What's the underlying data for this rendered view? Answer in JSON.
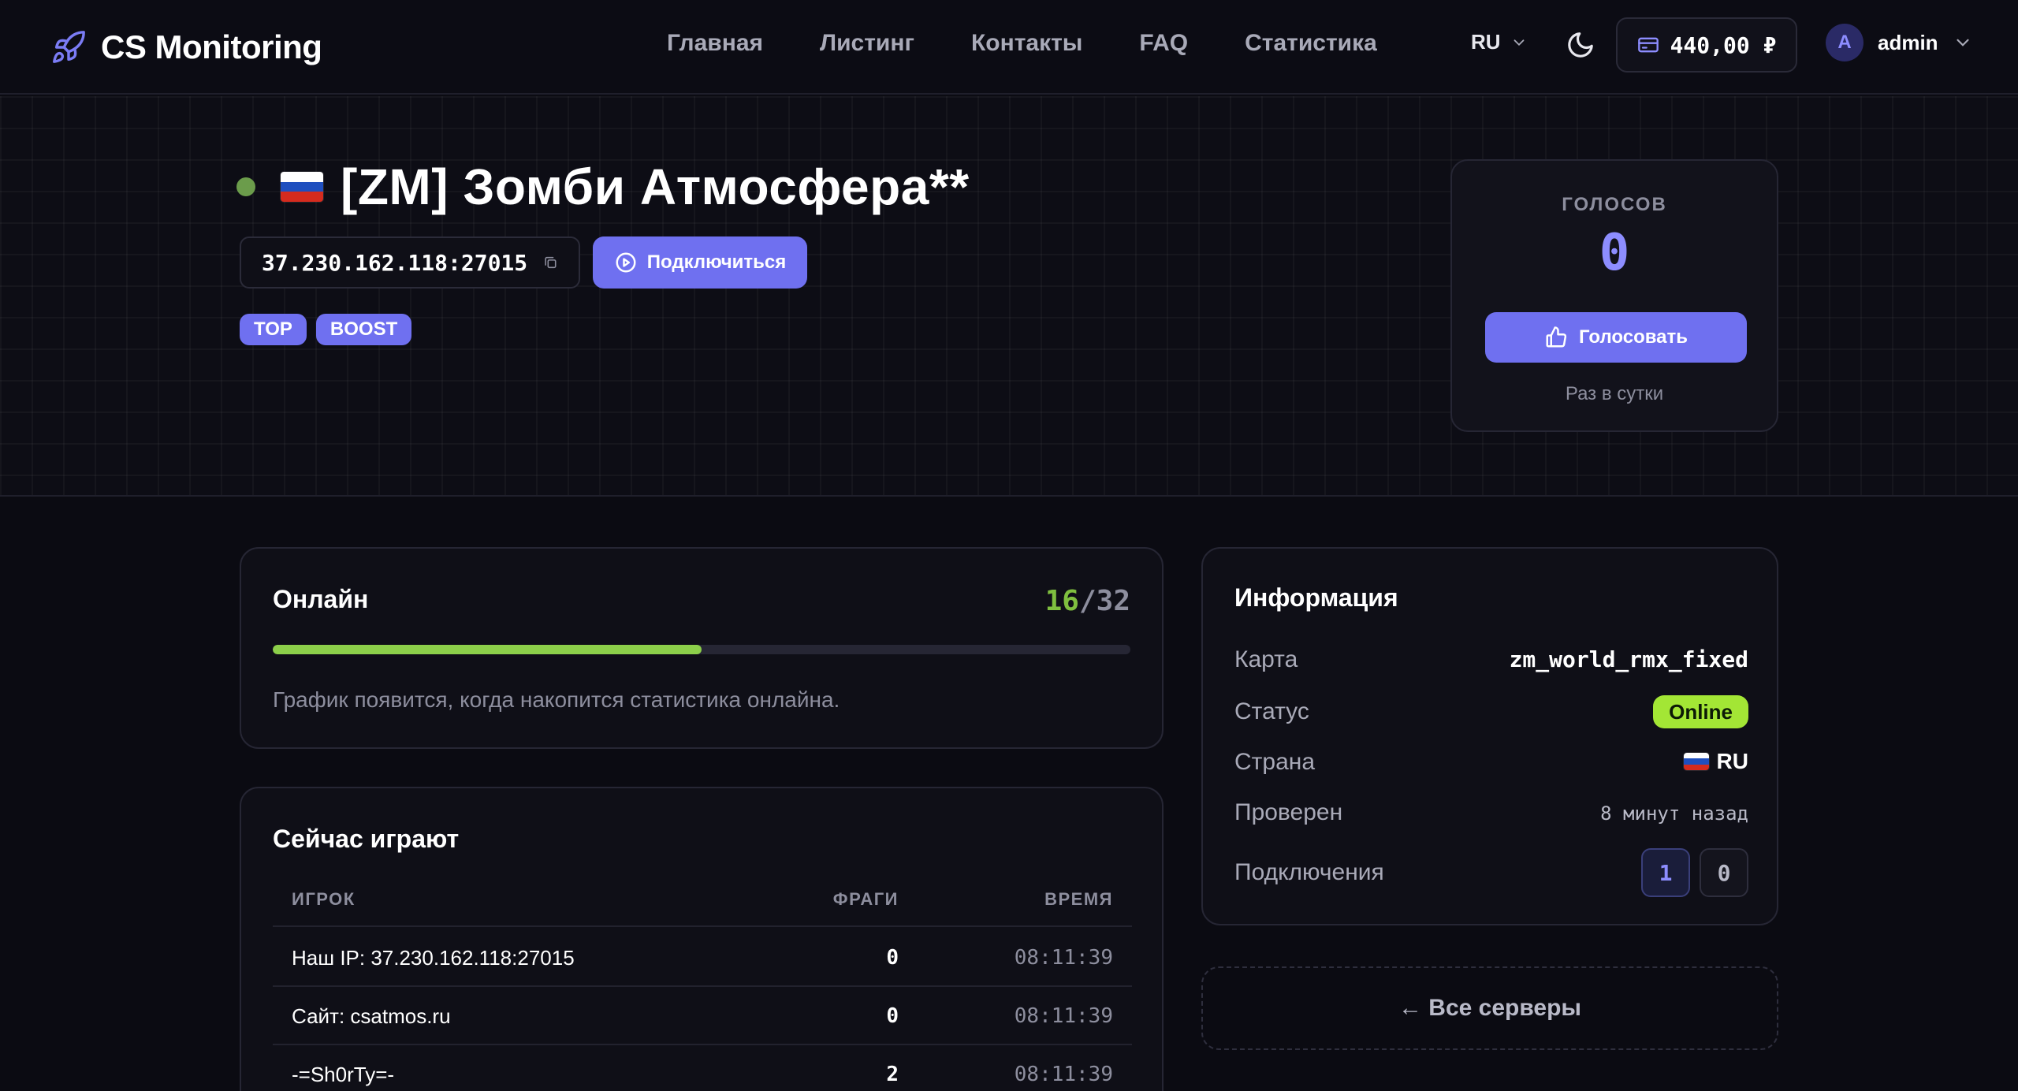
{
  "header": {
    "brand": "CS Monitoring",
    "nav": [
      "Главная",
      "Листинг",
      "Контакты",
      "FAQ",
      "Статистика"
    ],
    "lang": "RU",
    "balance": "440,00 ₽",
    "avatar_letter": "A",
    "username": "admin"
  },
  "server": {
    "title": "[ZM] Зомби Атмосфера**",
    "ip": "37.230.162.118:27015",
    "connect_label": "Подключиться",
    "tags": [
      "TOP",
      "BOOST"
    ]
  },
  "vote": {
    "label": "ГОЛОСОВ",
    "count": "0",
    "button_label": "Голосовать",
    "note": "Раз в сутки"
  },
  "online": {
    "title": "Онлайн",
    "current": "16",
    "separator": "/",
    "max": "32",
    "fraction": 0.5,
    "note": "График появится, когда накопится статистика онлайна."
  },
  "players": {
    "title": "Сейчас играют",
    "columns": [
      "ИГРОК",
      "ФРАГИ",
      "ВРЕМЯ"
    ],
    "rows": [
      {
        "name": "Наш IP: 37.230.162.118:27015",
        "frags": "0",
        "time": "08:11:39"
      },
      {
        "name": "Сайт: csatmos.ru",
        "frags": "0",
        "time": "08:11:39"
      },
      {
        "name": "-=Sh0rTy=-",
        "frags": "2",
        "time": "08:11:39"
      }
    ]
  },
  "info": {
    "title": "Информация",
    "map_label": "Карта",
    "map_value": "zm_world_rmx_fixed",
    "status_label": "Статус",
    "status_value": "Online",
    "country_label": "Страна",
    "country_value": "RU",
    "checked_label": "Проверен",
    "checked_value": "8 минут назад",
    "connections_label": "Подключения",
    "connections": [
      "1",
      "0"
    ]
  },
  "all_servers": "← Все серверы",
  "colors": {
    "accent": "#6f70f0",
    "online_green": "#8ccf4a",
    "status_badge": "#a3e635"
  }
}
